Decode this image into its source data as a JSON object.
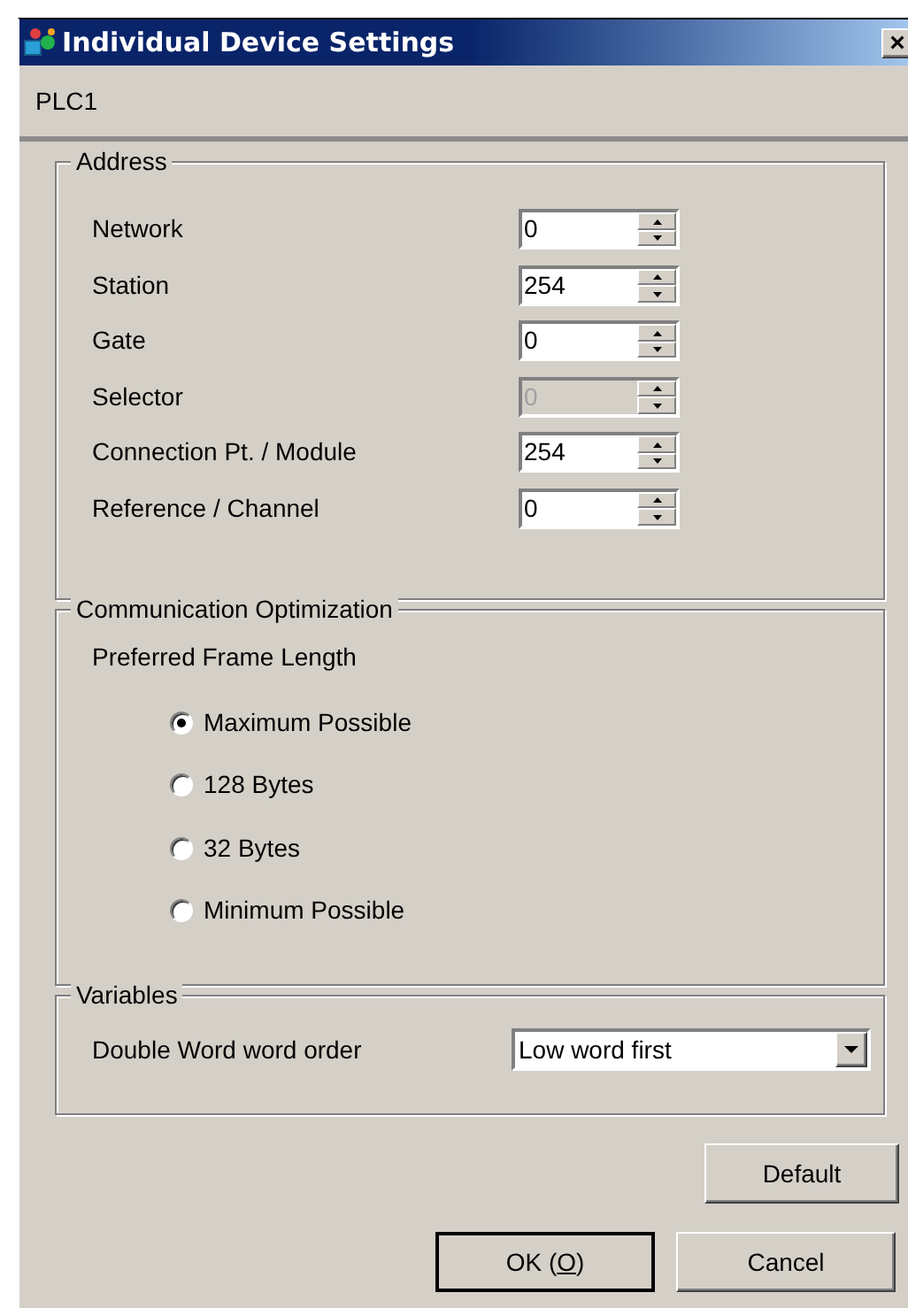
{
  "window": {
    "title": "Individual Device Settings",
    "close": "×"
  },
  "device": "PLC1",
  "address": {
    "title": "Address",
    "fields": [
      {
        "label": "Network",
        "value": "0",
        "disabled": false
      },
      {
        "label": "Station",
        "value": "254",
        "disabled": false
      },
      {
        "label": "Gate",
        "value": "0",
        "disabled": false
      },
      {
        "label": "Selector",
        "value": "0",
        "disabled": true
      },
      {
        "label": "Connection Pt. / Module",
        "value": "254",
        "disabled": false
      },
      {
        "label": "Reference / Channel",
        "value": "0",
        "disabled": false
      }
    ]
  },
  "optimization": {
    "title": "Communication Optimization",
    "subtitle": "Preferred Frame Length",
    "options": [
      {
        "label": "Maximum Possible",
        "selected": true
      },
      {
        "label": "128 Bytes",
        "selected": false
      },
      {
        "label": "32 Bytes",
        "selected": false
      },
      {
        "label": "Minimum Possible",
        "selected": false
      }
    ]
  },
  "variables": {
    "title": "Variables",
    "label": "Double Word word order",
    "value": "Low word first"
  },
  "buttons": {
    "default": "Default",
    "ok": {
      "before": "OK (",
      "accel": "O",
      "after": ")"
    },
    "cancel": "Cancel"
  }
}
